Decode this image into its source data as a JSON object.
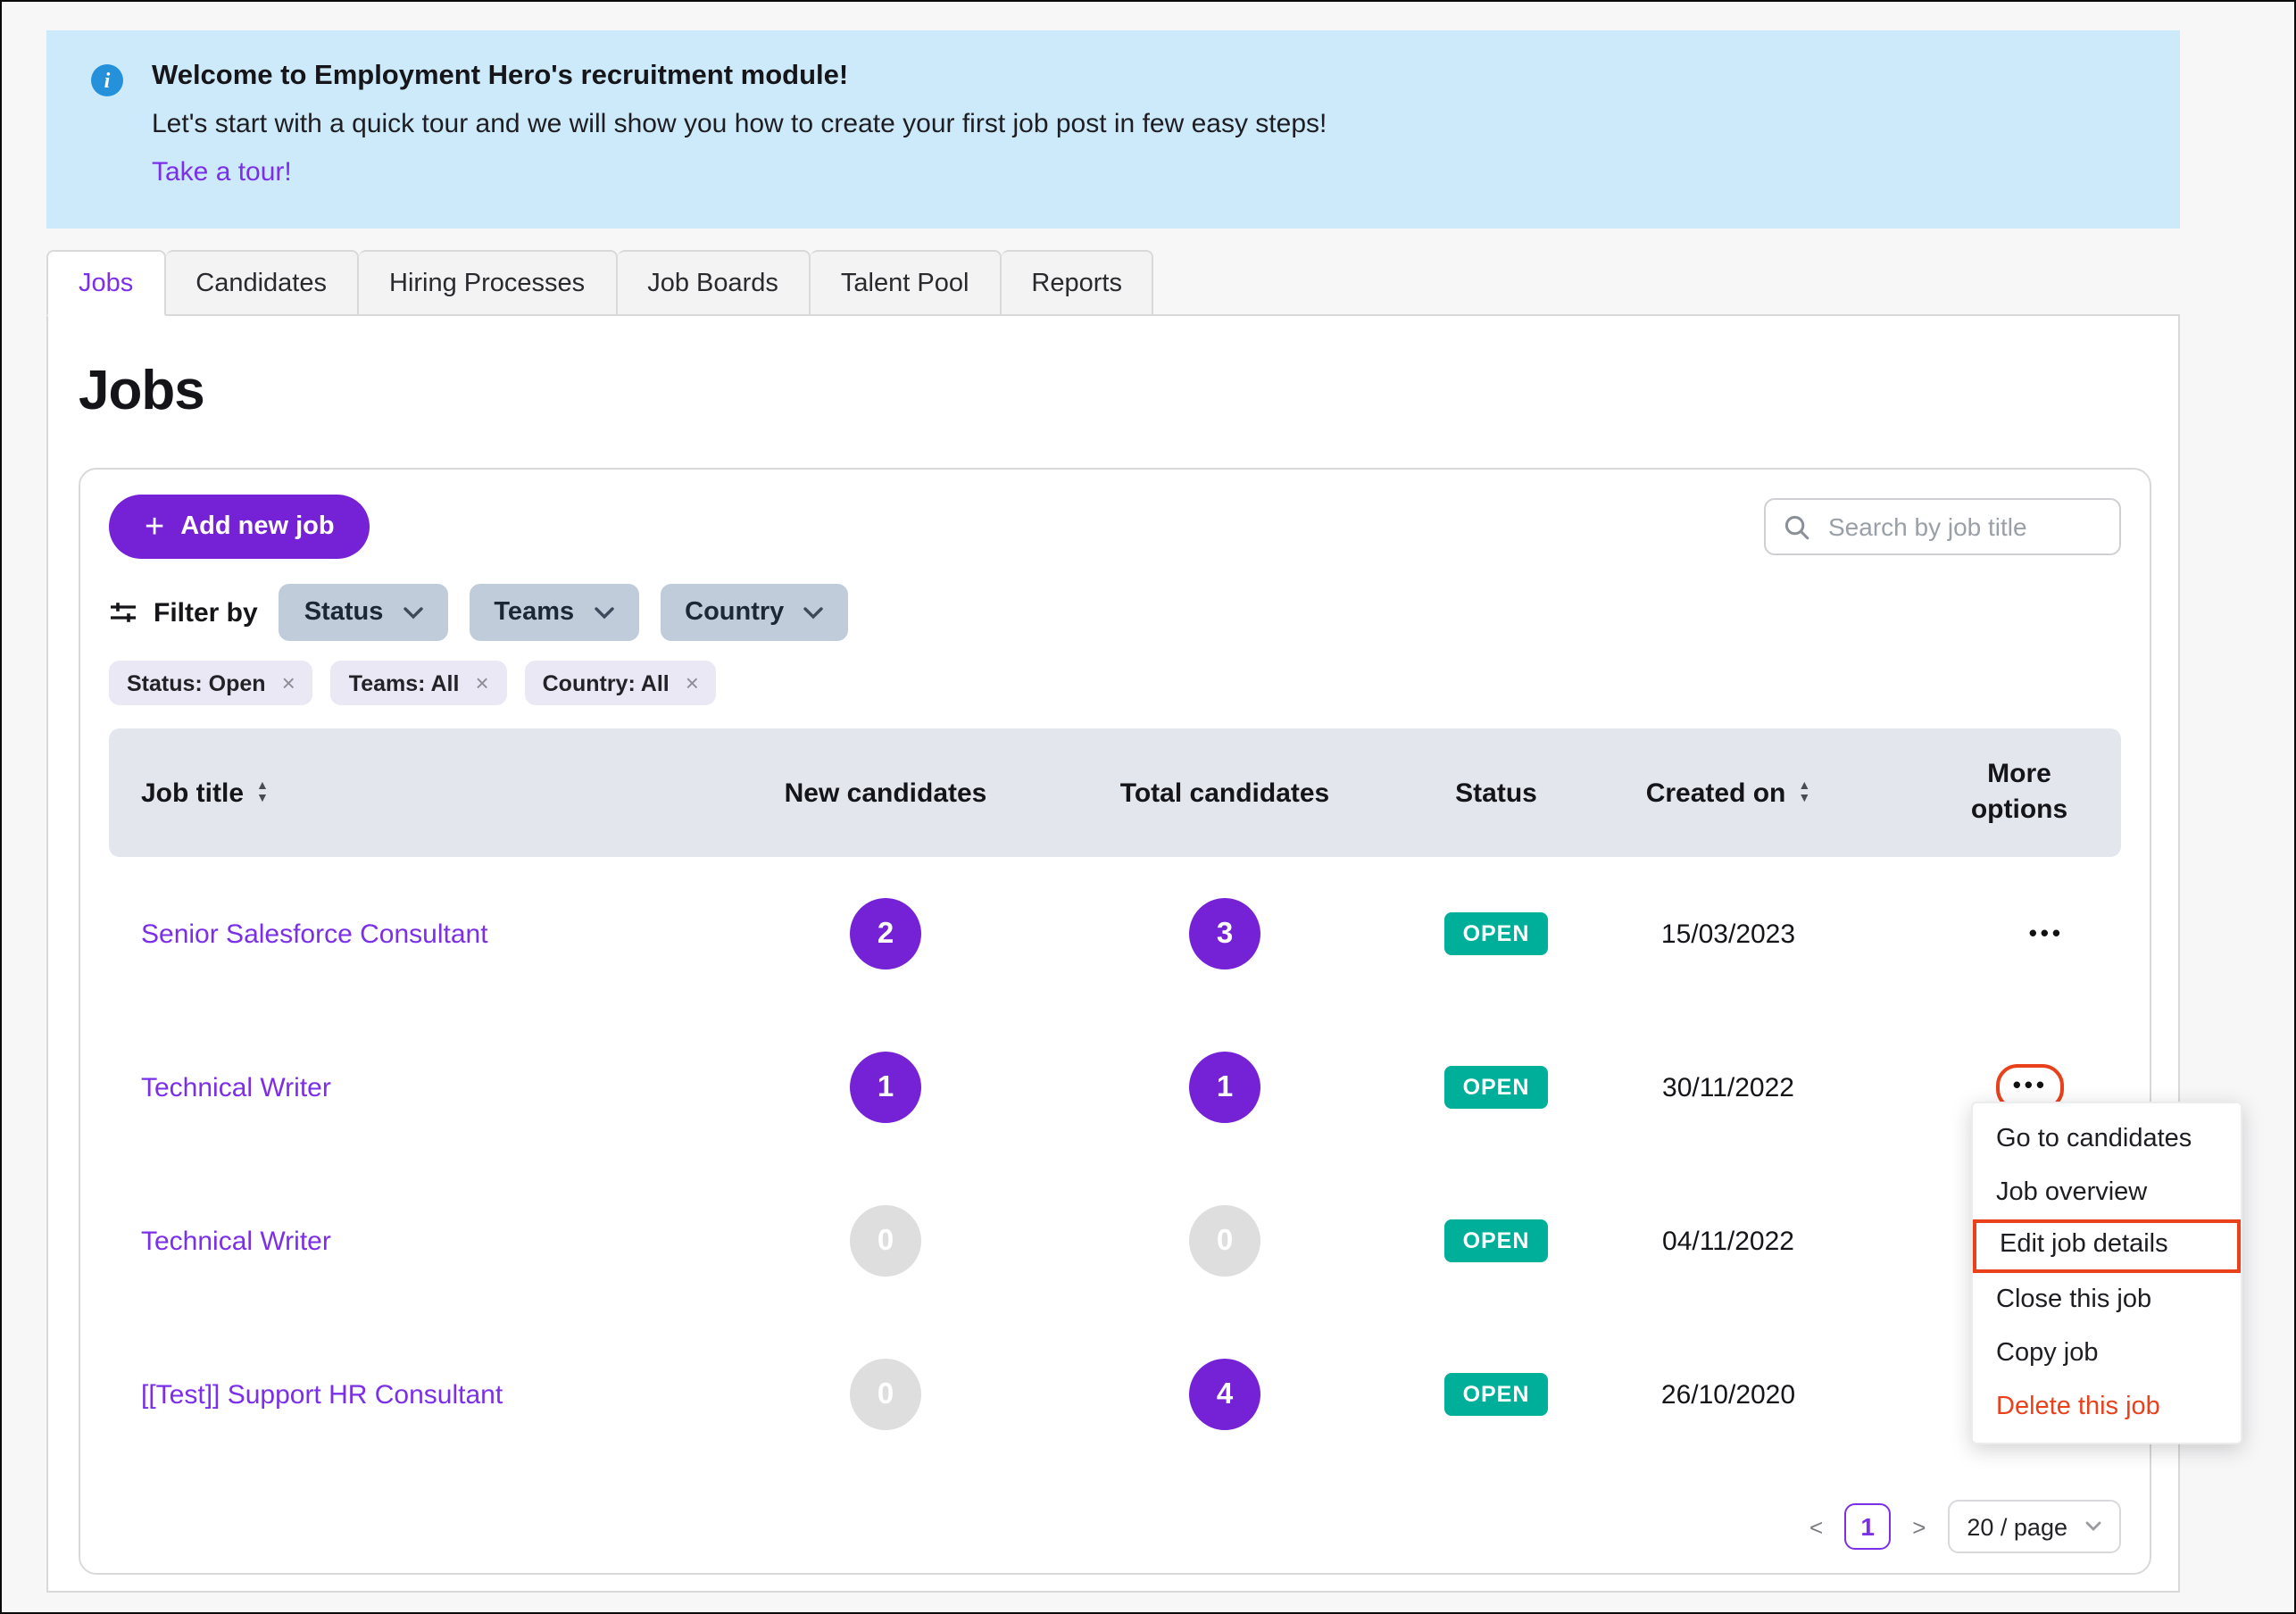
{
  "banner": {
    "title": "Welcome to Employment Hero's recruitment module!",
    "subtitle": "Let's start with a quick tour and we will show you how to create your first job post in few easy steps!",
    "link": "Take a tour!"
  },
  "tabs": [
    {
      "label": "Jobs"
    },
    {
      "label": "Candidates"
    },
    {
      "label": "Hiring Processes"
    },
    {
      "label": "Job Boards"
    },
    {
      "label": "Talent Pool"
    },
    {
      "label": "Reports"
    }
  ],
  "page_title": "Jobs",
  "toolbar": {
    "add_label": "Add new job",
    "plus_glyph": "+",
    "search_placeholder": "Search by job title"
  },
  "filters": {
    "label": "Filter by",
    "dropdowns": [
      "Status",
      "Teams",
      "Country"
    ],
    "applied": [
      "Status: Open",
      "Teams: All",
      "Country: All"
    ],
    "close_glyph": "×"
  },
  "table": {
    "columns": [
      "Job title",
      "New candidates",
      "Total candidates",
      "Status",
      "Created on",
      "More options"
    ],
    "more_glyph": "•••",
    "rows": [
      {
        "title": "Senior Salesforce Consultant",
        "new": "2",
        "total": "3",
        "status": "OPEN",
        "created": "15/03/2023"
      },
      {
        "title": "Technical Writer",
        "new": "1",
        "total": "1",
        "status": "OPEN",
        "created": "30/11/2022"
      },
      {
        "title": "Technical Writer",
        "new": "0",
        "total": "0",
        "status": "OPEN",
        "created": "04/11/2022"
      },
      {
        "title": "[[Test]] Support HR Consultant",
        "new": "0",
        "total": "4",
        "status": "OPEN",
        "created": "26/10/2020"
      }
    ]
  },
  "context_menu": {
    "items": [
      "Go to candidates",
      "Job overview",
      "Edit job details",
      "Close this job",
      "Copy job",
      "Delete this job"
    ]
  },
  "pagination": {
    "prev": "<",
    "page": "1",
    "next": ">",
    "page_size": "20 / page"
  },
  "icons": {
    "sort_up": "▲",
    "sort_down": "▼",
    "info": "i",
    "chevron": "⌄"
  },
  "colors": {
    "accent_purple": "#7522D6",
    "link_purple": "#7B2FE8",
    "status_teal": "#00AF9A",
    "annotation_red": "#E8411C",
    "banner_blue": "#CDEAFB",
    "header_gray": "#E3E7ED"
  }
}
